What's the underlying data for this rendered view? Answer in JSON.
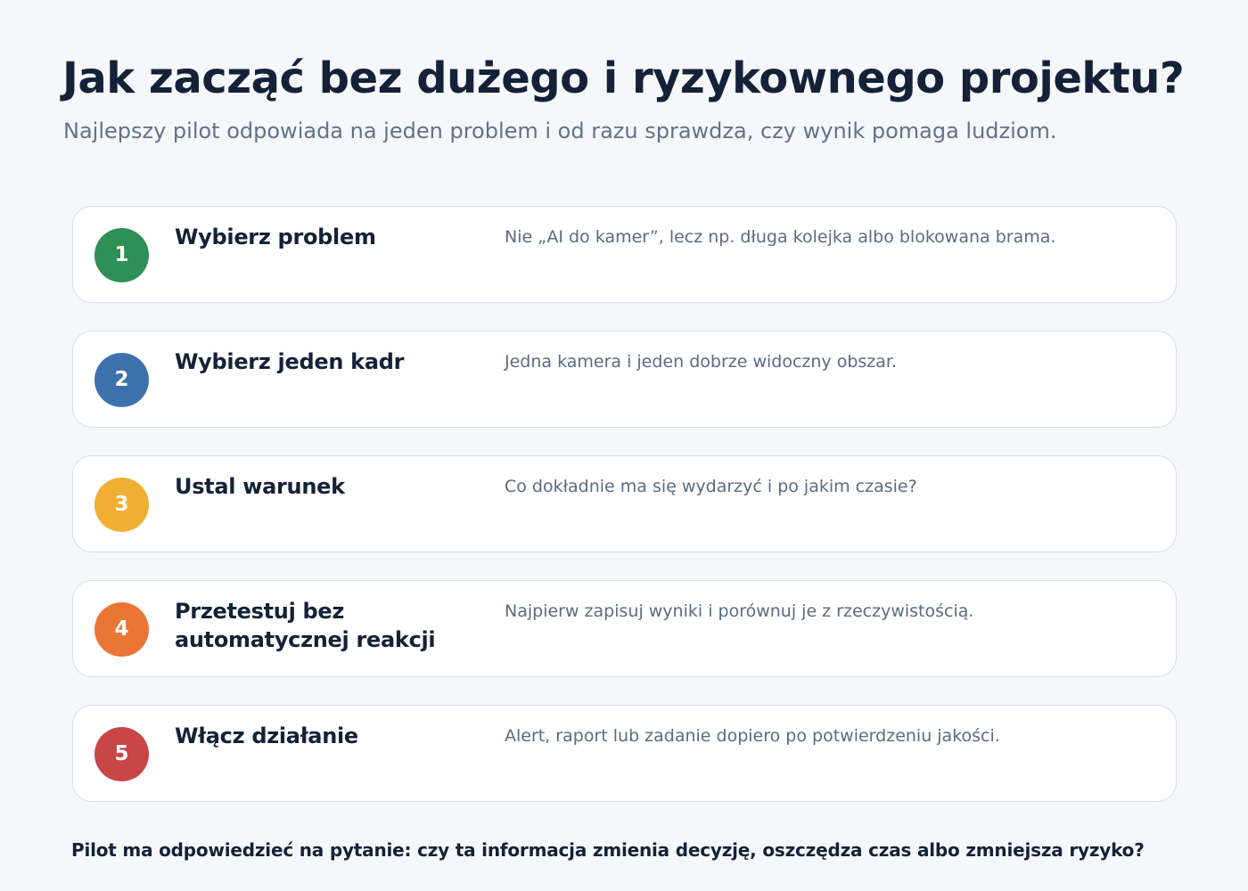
{
  "header": {
    "title": "Jak zacząć bez dużego i ryzykownego projektu?",
    "subtitle": "Najlepszy pilot odpowiada na jeden problem i od razu sprawdza, czy wynik pomaga ludziom."
  },
  "steps": [
    {
      "number": "1",
      "title": "Wybierz problem",
      "description": "Nie „AI do kamer”, lecz np. długa kolejka albo blokowana brama.",
      "color": "#2e8f57"
    },
    {
      "number": "2",
      "title": "Wybierz jeden kadr",
      "description": "Jedna kamera i jeden dobrze widoczny obszar.",
      "color": "#3d71ad"
    },
    {
      "number": "3",
      "title": "Ustal warunek",
      "description": "Co dokładnie ma się wydarzyć i po jakim czasie?",
      "color": "#f0ae33"
    },
    {
      "number": "4",
      "title": "Przetestuj bez automatycznej reakcji",
      "description": "Najpierw zapisuj wyniki i porównuj je z rzeczywistością.",
      "color": "#ea7535"
    },
    {
      "number": "5",
      "title": "Włącz działanie",
      "description": "Alert, raport lub zadanie dopiero po potwierdzeniu jakości.",
      "color": "#c94646"
    }
  ],
  "footer": {
    "note": "Pilot ma odpowiedzieć na pytanie: czy ta informacja zmienia decyzję, oszczędza czas albo zmniejsza ryzyko?"
  }
}
